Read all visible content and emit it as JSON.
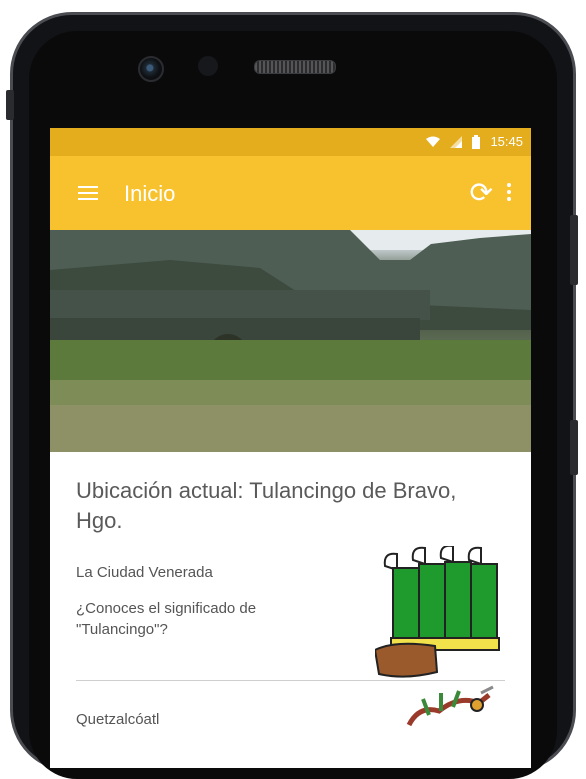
{
  "status_bar": {
    "time": "15:45",
    "icons": [
      "wifi-icon",
      "signal-icon",
      "battery-icon"
    ]
  },
  "toolbar": {
    "title": "Inicio",
    "menu_icon": "menu-icon",
    "refresh_icon": "refresh-icon",
    "overflow_icon": "more-vert-icon"
  },
  "location": {
    "title": "Ubicación actual: Tulancingo de Bravo, Hgo."
  },
  "cards": [
    {
      "heading": "La Ciudad Venerada",
      "description": "¿Conoces el significado de \"Tulancingo\"?",
      "image_icon": "tulancingo-glyph-icon"
    },
    {
      "heading": "Quetzalcóatl",
      "image_icon": "quetzalcoatl-glyph-icon"
    }
  ],
  "colors": {
    "status_bar": "#e4ad1d",
    "toolbar": "#f8c22f",
    "text": "#555555"
  }
}
